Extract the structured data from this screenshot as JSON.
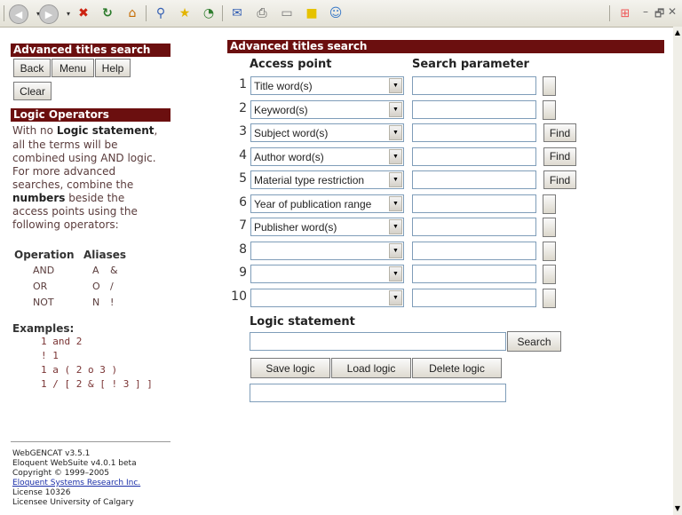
{
  "toolbar": {
    "icons": [
      "back-icon",
      "forward-icon",
      "stop-icon",
      "refresh-icon",
      "home-icon",
      "search-icon",
      "favorites-icon",
      "history-icon",
      "mail-icon",
      "print-icon",
      "edit-icon",
      "note-icon",
      "messenger-icon",
      "windows-logo-icon"
    ],
    "window_controls": {
      "minimize": "–",
      "restore": "🗗",
      "close": "✕"
    }
  },
  "left": {
    "header": "Advanced titles search",
    "buttons": {
      "back": "Back",
      "menu": "Menu",
      "help": "Help",
      "clear": "Clear"
    },
    "logic_header": "Logic Operators",
    "intro": {
      "l1a": "With no ",
      "l1b": "Logic statement",
      "l1c": ",",
      "l2": "all the terms will be",
      "l3": "combined using AND logic.",
      "l4": "For more advanced",
      "l5": "searches, combine the",
      "l6a": "numbers",
      "l6b": " beside the",
      "l7": "access points using the",
      "l8": "following operators:"
    },
    "operators": {
      "head_op": "Operation",
      "head_alias": "Aliases",
      "rows": [
        {
          "op": "AND",
          "a1": "A",
          "a2": "&"
        },
        {
          "op": "OR",
          "a1": "O",
          "a2": "/"
        },
        {
          "op": "NOT",
          "a1": "N",
          "a2": "!"
        }
      ]
    },
    "examples_header": "Examples:",
    "examples": [
      "1 and 2",
      "! 1",
      "1 a ( 2 o 3 )",
      "1 / [ 2 & [ ! 3 ] ]"
    ],
    "footer": {
      "l1": "WebGENCAT v3.5.1",
      "l2": "Eloquent WebSuite v4.0.1 beta",
      "l3": "Copyright © 1999–2005",
      "l4": "Eloquent Systems Research Inc.",
      "l5": "License 10326",
      "l6": "Licensee University of Calgary"
    }
  },
  "main": {
    "header": "Advanced titles search",
    "col_access": "Access point",
    "col_search": "Search parameter",
    "rows": [
      {
        "num": "1",
        "access": "Title word(s)",
        "find": ""
      },
      {
        "num": "2",
        "access": "Keyword(s)",
        "find": ""
      },
      {
        "num": "3",
        "access": "Subject word(s)",
        "find": "Find"
      },
      {
        "num": "4",
        "access": "Author word(s)",
        "find": "Find"
      },
      {
        "num": "5",
        "access": "Material type restriction",
        "find": "Find"
      },
      {
        "num": "6",
        "access": "Year of publication range",
        "find": ""
      },
      {
        "num": "7",
        "access": "Publisher word(s)",
        "find": ""
      },
      {
        "num": "8",
        "access": "",
        "find": ""
      },
      {
        "num": "9",
        "access": "",
        "find": ""
      },
      {
        "num": "10",
        "access": "",
        "find": ""
      }
    ],
    "logic_label": "Logic statement",
    "logic_value": "",
    "search_button": "Search",
    "save_logic": "Save logic",
    "load_logic": "Load logic",
    "delete_logic": "Delete logic",
    "logic_name_value": ""
  }
}
